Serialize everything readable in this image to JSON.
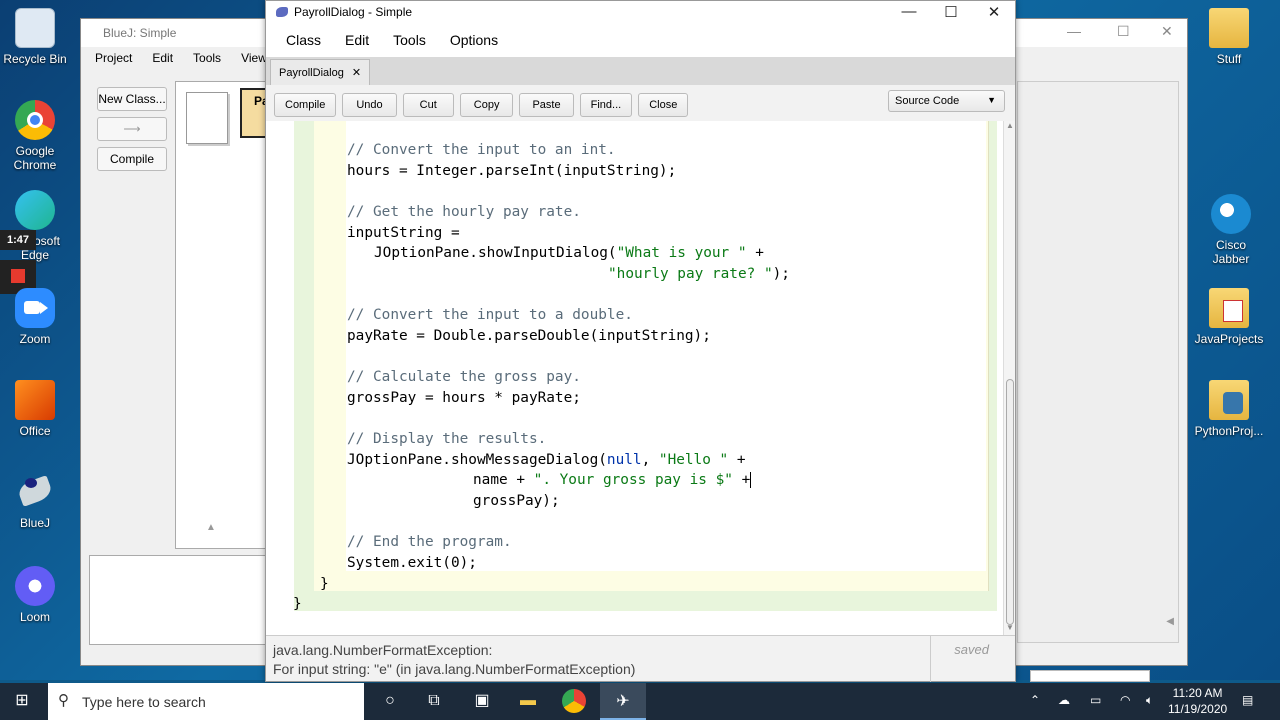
{
  "desktop": {
    "left_icons": [
      {
        "label": "Recycle Bin",
        "icon": "recycle-bin-icon",
        "color": "#d9e6f2"
      },
      {
        "label": "Google Chrome",
        "icon": "chrome-icon",
        "color": "#34a853"
      },
      {
        "label": "Microsoft Edge",
        "icon": "edge-icon",
        "color": "#1fb5a9"
      },
      {
        "label": "Zoom",
        "icon": "zoom-icon",
        "color": "#2d8cff"
      },
      {
        "label": "Office",
        "icon": "office-icon",
        "color": "#e64a19"
      },
      {
        "label": "BlueJ",
        "icon": "bluej-icon",
        "color": "#cfd8dc"
      },
      {
        "label": "Loom",
        "icon": "loom-icon",
        "color": "#625df5"
      }
    ],
    "left_labels": {
      "recycle": "Recycle Bin",
      "chrome1": "Google",
      "chrome2": "Chrome",
      "edge1": "osoft",
      "edge2": "Edge",
      "zoom": "Zoom",
      "office": "Office",
      "bluej": "BlueJ",
      "loom": "Loom"
    },
    "right_icons": {
      "stuff": "Stuff",
      "jabber": "Cisco Jabber",
      "java": "JavaProjects",
      "python": "PythonProj..."
    },
    "recording_timer": "1:47"
  },
  "bluej_window": {
    "title": "BlueJ:  Simple",
    "menu": [
      "Project",
      "Edit",
      "Tools",
      "View"
    ],
    "new_class": "New Class...",
    "compile": "Compile",
    "class_label": "Pa"
  },
  "editor": {
    "title": "PayrollDialog - Simple",
    "menu": {
      "class": "Class",
      "edit": "Edit",
      "tools": "Tools",
      "options": "Options"
    },
    "tab": "PayrollDialog",
    "toolbar": {
      "compile": "Compile",
      "undo": "Undo",
      "cut": "Cut",
      "copy": "Copy",
      "paste": "Paste",
      "find": "Find...",
      "close": "Close"
    },
    "view_select": "Source Code",
    "code": {
      "l1": "// Convert the input to an int.",
      "l2": "hours = Integer.parseInt(inputString);",
      "l3": "// Get the hourly pay rate.",
      "l4": "inputString =",
      "l5a": "JOptionPane.showInputDialog(",
      "l5b": "\"What is your \"",
      "l5c": " +",
      "l6": "\"hourly pay rate? \"",
      "l6c": ");",
      "l7": "// Convert the input to a double.",
      "l8": "payRate = Double.parseDouble(inputString);",
      "l9": "// Calculate the gross pay.",
      "l10": "grossPay = hours * payRate;",
      "l11": "// Display the results.",
      "l12a": "JOptionPane.showMessageDialog(",
      "l12b": "null",
      "l12c": ", ",
      "l12d": "\"Hello \"",
      "l12e": " +",
      "l13a": "name + ",
      "l13b": "\". Your gross pay is $\"",
      "l13c": " +",
      "l14": "grossPay);",
      "l15": "// End the program.",
      "l16": "System.exit(0);",
      "l17": "}",
      "l18": "}"
    },
    "status_line1": "java.lang.NumberFormatException:",
    "status_line2": "For input string: \"e\" (in java.lang.NumberFormatException)",
    "saved": "saved"
  },
  "taskbar": {
    "search_placeholder": "Type here to search",
    "time": "11:20 AM",
    "date": "11/19/2020"
  }
}
